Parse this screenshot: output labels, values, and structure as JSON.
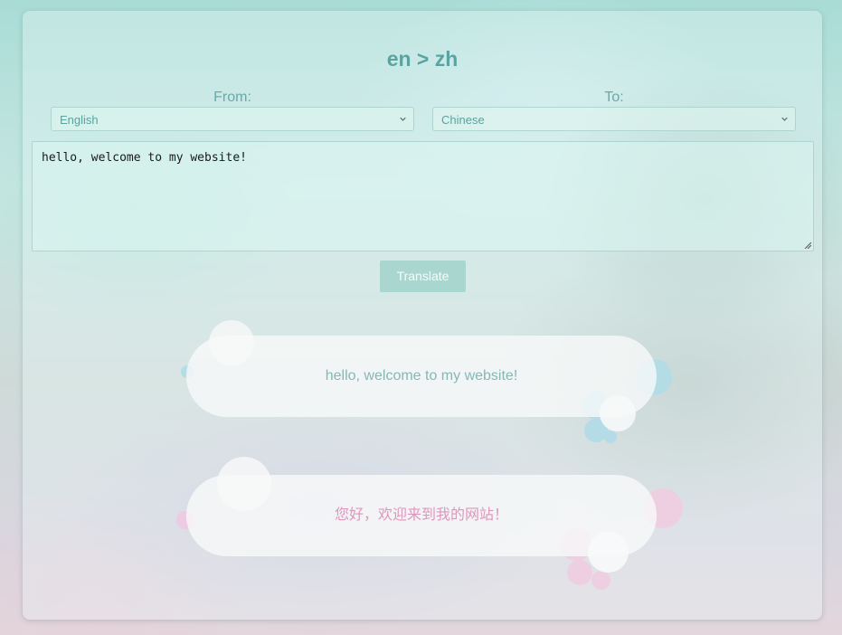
{
  "header": {
    "title": "en > zh"
  },
  "from": {
    "label": "From:",
    "selected": "English"
  },
  "to": {
    "label": "To:",
    "selected": "Chinese"
  },
  "input": {
    "value": "hello, welcome to my website!"
  },
  "actions": {
    "translate_label": "Translate"
  },
  "output": {
    "source_text": "hello, welcome to my website!",
    "translated_text": "您好，欢迎来到我的网站！"
  },
  "colors": {
    "accent": "#5aa3a0",
    "button": "#a9d7d0",
    "source_bubble_text": "#84b8b6",
    "target_bubble_text": "#de97bc"
  },
  "icons": {
    "select_arrow": "chevron-down-icon",
    "resize": "resize-handle-icon"
  }
}
